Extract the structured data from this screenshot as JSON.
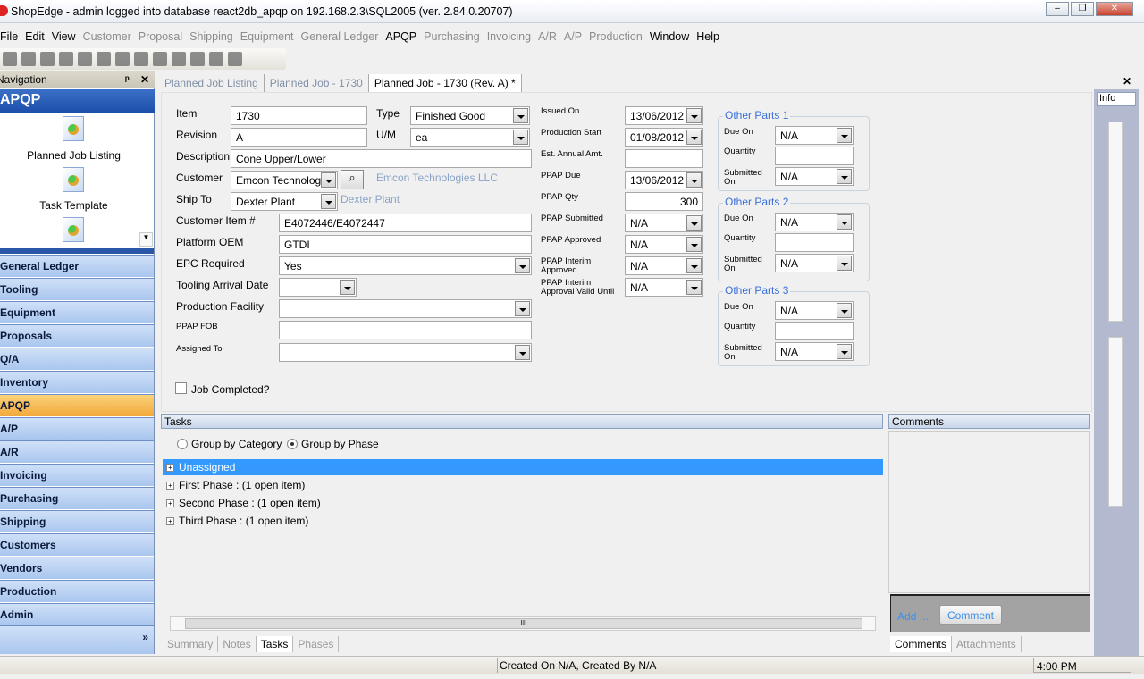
{
  "window": {
    "title": "ShopEdge - admin logged into database react2db_apqp on 192.168.2.3\\SQL2005 (ver. 2.84.0.20707)",
    "minimize": "‒",
    "restore": "❐",
    "close": "✕",
    "close_doc": "✕"
  },
  "menu": [
    {
      "label": "File",
      "enabled": true
    },
    {
      "label": "Edit",
      "enabled": true
    },
    {
      "label": "View",
      "enabled": true
    },
    {
      "label": "Customer",
      "enabled": false
    },
    {
      "label": "Proposal",
      "enabled": false
    },
    {
      "label": "Shipping",
      "enabled": false
    },
    {
      "label": "Equipment",
      "enabled": false
    },
    {
      "label": "General Ledger",
      "enabled": false
    },
    {
      "label": "APQP",
      "enabled": true
    },
    {
      "label": "Purchasing",
      "enabled": false
    },
    {
      "label": "Invoicing",
      "enabled": false
    },
    {
      "label": "A/R",
      "enabled": false
    },
    {
      "label": "A/P",
      "enabled": false
    },
    {
      "label": "Production",
      "enabled": false
    },
    {
      "label": "Window",
      "enabled": true
    },
    {
      "label": "Help",
      "enabled": true
    }
  ],
  "toolbar": [
    "new-icon",
    "save-icon",
    "save-all-icon",
    "print-icon",
    "print-preview-icon",
    "cut-icon",
    "copy-icon",
    "paste-icon",
    "add-row-icon",
    "delete-row-icon",
    "export-icon",
    "refresh-icon",
    "edit-icon"
  ],
  "navigation": {
    "header": "Navigation",
    "pin": "ᵖ",
    "close": "✕",
    "section_title": "APQP",
    "items": [
      {
        "label": "Planned Job Listing"
      },
      {
        "label": "Task Template"
      }
    ],
    "groups": [
      "General Ledger",
      "Tooling",
      "Equipment",
      "Proposals",
      "Q/A",
      "Inventory",
      "APQP",
      "A/P",
      "A/R",
      "Invoicing",
      "Purchasing",
      "Shipping",
      "Customers",
      "Vendors",
      "Production",
      "Admin"
    ],
    "active_group": "APQP",
    "more": "»"
  },
  "tabs": [
    {
      "label": "Planned Job Listing",
      "active": false
    },
    {
      "label": "Planned Job - 1730",
      "active": false
    },
    {
      "label": "Planned Job - 1730 (Rev. A) *",
      "active": true
    }
  ],
  "form": {
    "item": {
      "label": "Item",
      "value": "1730"
    },
    "type": {
      "label": "Type",
      "value": "Finished Good"
    },
    "revision": {
      "label": "Revision",
      "value": "A"
    },
    "um": {
      "label": "U/M",
      "value": "ea"
    },
    "description": {
      "label": "Description",
      "value": "Cone Upper/Lower"
    },
    "customer": {
      "label": "Customer",
      "value": "Emcon Technologi",
      "link": "Emcon Technologies LLC"
    },
    "ship_to": {
      "label": "Ship To",
      "value": "Dexter Plant",
      "link": "Dexter Plant"
    },
    "customer_item": {
      "label": "Customer Item #",
      "value": "E4072446/E4072447"
    },
    "platform_oem": {
      "label": "Platform OEM",
      "value": "GTDI"
    },
    "epc_required": {
      "label": "EPC Required",
      "value": "Yes"
    },
    "tooling_arrival": {
      "label": "Tooling Arrival Date",
      "value": ""
    },
    "production_facility": {
      "label": "Production Facility",
      "value": ""
    },
    "ppap_fob": {
      "label": "PPAP FOB",
      "value": ""
    },
    "assigned_to": {
      "label": "Assigned To",
      "value": ""
    },
    "job_completed": {
      "label": "Job Completed?",
      "checked": false
    },
    "issued_on": {
      "label": "Issued On",
      "value": "13/06/2012"
    },
    "production_start": {
      "label": "Production Start",
      "value": "01/08/2012"
    },
    "est_annual": {
      "label": "Est. Annual Amt.",
      "value": ""
    },
    "ppap_due": {
      "label": "PPAP Due",
      "value": "13/06/2012"
    },
    "ppap_qty": {
      "label": "PPAP Qty",
      "value": "300"
    },
    "ppap_submitted": {
      "label": "PPAP Submitted",
      "value": "N/A"
    },
    "ppap_approved": {
      "label": "PPAP Approved",
      "value": "N/A"
    },
    "ppap_interim": {
      "label": "PPAP Interim Approved",
      "value": "N/A"
    },
    "ppap_interim_valid": {
      "label": "PPAP Interim Approval Valid Until",
      "value": "N/A"
    },
    "other_parts": [
      {
        "title": "Other Parts 1",
        "due_label": "Due On",
        "due": "N/A",
        "qty_label": "Quantity",
        "qty": "",
        "sub_label": "Submitted On",
        "sub": "N/A"
      },
      {
        "title": "Other Parts 2",
        "due_label": "Due On",
        "due": "N/A",
        "qty_label": "Quantity",
        "qty": "",
        "sub_label": "Submitted On",
        "sub": "N/A"
      },
      {
        "title": "Other Parts 3",
        "due_label": "Due On",
        "due": "N/A",
        "qty_label": "Quantity",
        "qty": "",
        "sub_label": "Submitted On",
        "sub": "N/A"
      }
    ]
  },
  "info": {
    "label": "Info"
  },
  "tasks": {
    "header": "Tasks",
    "group_by_category": "Group by Category",
    "group_by_phase": "Group by Phase",
    "selected_grouping": "phase",
    "rows": [
      {
        "label": "Unassigned",
        "selected": true
      },
      {
        "label": "First Phase : (1 open item)",
        "selected": false
      },
      {
        "label": "Second Phase : (1 open item)",
        "selected": false
      },
      {
        "label": "Third Phase : (1 open item)",
        "selected": false
      }
    ],
    "bottom_tabs": [
      {
        "label": "Summary",
        "active": false
      },
      {
        "label": "Notes",
        "active": false
      },
      {
        "label": "Tasks",
        "active": true
      },
      {
        "label": "Phases",
        "active": false
      }
    ],
    "scroll_grip": "III"
  },
  "comments": {
    "header": "Comments",
    "add": "Add ...",
    "comment_button": "Comment",
    "bottom_tabs": [
      {
        "label": "Comments",
        "active": true
      },
      {
        "label": "Attachments",
        "active": false
      }
    ]
  },
  "status": {
    "created": "Created On N/A, Created By N/A",
    "time": "4:00 PM"
  }
}
